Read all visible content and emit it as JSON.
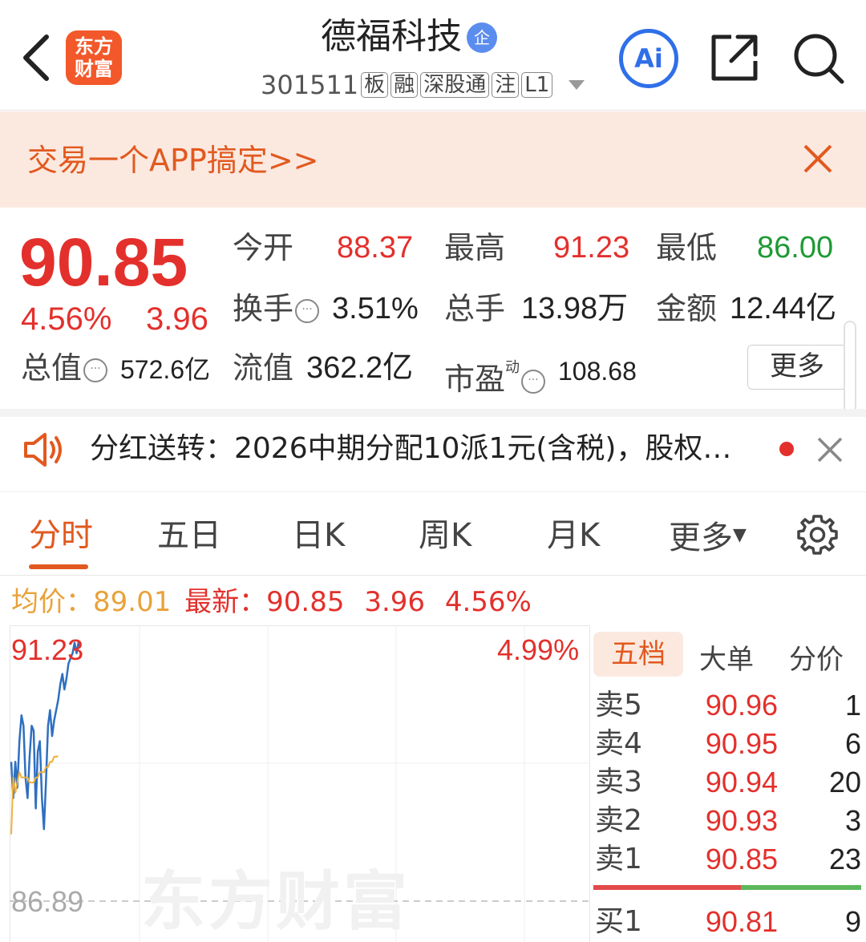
{
  "header": {
    "title": "德福科技",
    "title_badge": "企",
    "code": "301511",
    "tags": [
      "板",
      "融",
      "深股通",
      "注",
      "L1"
    ],
    "app_logo_line1": "东方",
    "app_logo_line2": "财富",
    "ai_label": "Ai"
  },
  "banner": {
    "text": "交易一个APP搞定>>"
  },
  "quote": {
    "price": "90.85",
    "change_pct": "4.56%",
    "change_amt": "3.96",
    "open_label": "今开",
    "open": "88.37",
    "high_label": "最高",
    "high": "91.23",
    "low_label": "最低",
    "low": "86.00",
    "turnover_label": "换手",
    "turnover": "3.51%",
    "volume_label": "总手",
    "volume": "13.98万",
    "amount_label": "金额",
    "amount": "12.44亿",
    "mktcap_label": "总值",
    "mktcap": "572.6亿",
    "float_label": "流值",
    "float": "362.2亿",
    "pe_label": "市盈",
    "pe_sup": "动",
    "pe": "108.68",
    "more_label": "更多"
  },
  "notice": {
    "text": "分红送转：2026中期分配10派1元(含税)，股权…"
  },
  "tabs": [
    "分时",
    "五日",
    "日K",
    "周K",
    "月K",
    "更多"
  ],
  "infoline": {
    "avg_label": "均价：",
    "avg": "89.01",
    "latest_label": "最新：",
    "latest": "90.85",
    "chg": "3.96",
    "pct": "4.56%"
  },
  "chart_labels": {
    "high": "91.23",
    "high_pct": "4.99%",
    "low": "86.89",
    "watermark": "东方财富"
  },
  "chart_data": {
    "type": "line",
    "ylim": [
      86.89,
      91.23
    ],
    "series": [
      {
        "name": "price",
        "color": "#2f6fc0",
        "values": [
          88.9,
          88.2,
          88.9,
          88.4,
          89.3,
          89.8,
          89.6,
          88.6,
          88.2,
          89.0,
          89.6,
          89.5,
          88.0,
          89.1,
          89.3,
          88.2,
          87.6,
          88.5,
          89.6,
          89.9,
          89.4,
          89.7,
          89.9,
          90.1,
          90.4,
          90.6,
          90.3,
          90.5,
          90.8,
          90.9,
          91.0,
          91.2,
          91.0,
          91.23
        ]
      },
      {
        "name": "avg",
        "color": "#f0b03a",
        "values": [
          87.5,
          88.6,
          88.3,
          88.5,
          88.7,
          88.6,
          88.6,
          88.6,
          88.6,
          88.5,
          88.5,
          88.5,
          88.6,
          88.6,
          88.7,
          88.7,
          88.7,
          88.8,
          88.8,
          88.9,
          88.9,
          89.0,
          89.0,
          89.01
        ]
      }
    ]
  },
  "orderbook": {
    "tabs": [
      "五档",
      "大单",
      "分价"
    ],
    "asks": [
      {
        "label": "卖5",
        "price": "90.96",
        "vol": "1"
      },
      {
        "label": "卖4",
        "price": "90.95",
        "vol": "6"
      },
      {
        "label": "卖3",
        "price": "90.94",
        "vol": "20"
      },
      {
        "label": "卖2",
        "price": "90.93",
        "vol": "3"
      },
      {
        "label": "卖1",
        "price": "90.85",
        "vol": "23"
      }
    ],
    "bids": [
      {
        "label": "买1",
        "price": "90.81",
        "vol": "9"
      }
    ]
  }
}
